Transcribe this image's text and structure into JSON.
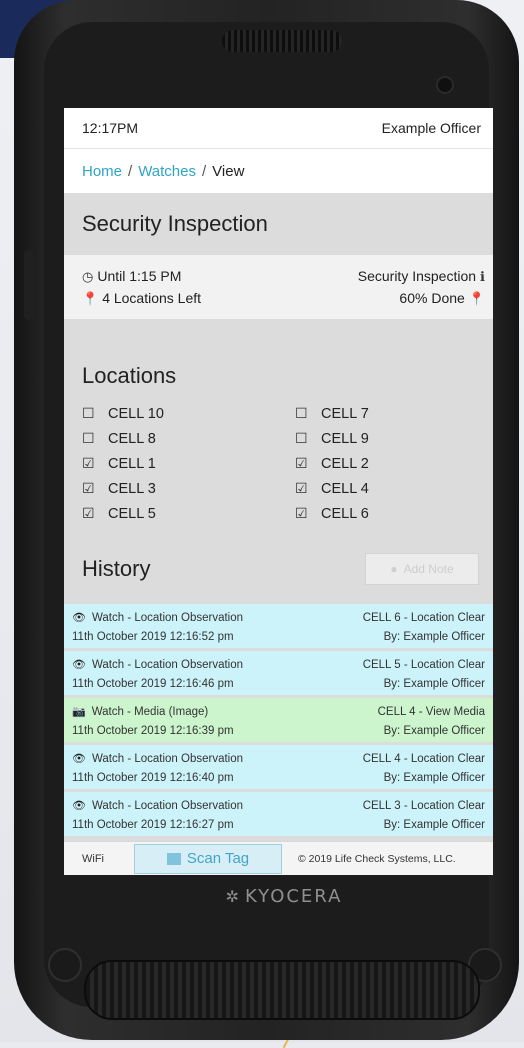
{
  "status_bar": {
    "time": "12:17PM",
    "user": "Example Officer"
  },
  "breadcrumb": {
    "home": "Home",
    "separator": "/",
    "watches": "Watches",
    "current": "View"
  },
  "watch": {
    "title": "Security Inspection",
    "until": "Until 1:15 PM",
    "type": "Security Inspection",
    "locations_left": "4 Locations Left",
    "done": "60% Done",
    "progress_fraction": 0.6
  },
  "locations": {
    "title": "Locations",
    "items": [
      {
        "label": "CELL 10",
        "checked": false
      },
      {
        "label": "CELL 7",
        "checked": false
      },
      {
        "label": "CELL 8",
        "checked": false
      },
      {
        "label": "CELL 9",
        "checked": false
      },
      {
        "label": "CELL 1",
        "checked": true
      },
      {
        "label": "CELL 2",
        "checked": true
      },
      {
        "label": "CELL 3",
        "checked": true
      },
      {
        "label": "CELL 4",
        "checked": true
      },
      {
        "label": "CELL 5",
        "checked": true
      },
      {
        "label": "CELL 6",
        "checked": true
      }
    ]
  },
  "history": {
    "title": "History",
    "add_note_label": "Add Note",
    "entries": [
      {
        "kind": "obs",
        "icon": "eye-icon",
        "event": "Watch - Location Observation",
        "timestamp": "11th October 2019 12:16:52 pm",
        "result": "CELL 6 - Location Clear",
        "by": "By: Example Officer"
      },
      {
        "kind": "obs",
        "icon": "eye-icon",
        "event": "Watch - Location Observation",
        "timestamp": "11th October 2019 12:16:46 pm",
        "result": "CELL 5 - Location Clear",
        "by": "By: Example Officer"
      },
      {
        "kind": "media",
        "icon": "camera-icon",
        "event": "Watch - Media (Image)",
        "timestamp": "11th October 2019 12:16:39 pm",
        "result": "CELL 4 - View Media",
        "by": "By: Example Officer"
      },
      {
        "kind": "obs",
        "icon": "eye-icon",
        "event": "Watch - Location Observation",
        "timestamp": "11th October 2019 12:16:40 pm",
        "result": "CELL 4 - Location Clear",
        "by": "By: Example Officer"
      },
      {
        "kind": "obs",
        "icon": "eye-icon",
        "event": "Watch - Location Observation",
        "timestamp": "11th October 2019 12:16:27 pm",
        "result": "CELL 3 - Location Clear",
        "by": "By: Example Officer"
      }
    ]
  },
  "footer": {
    "wifi": "WiFi",
    "scan_label": "Scan Tag",
    "copyright": "© 2019 Life Check Systems, LLC."
  },
  "device": {
    "brand": "KYOCERA"
  },
  "colors": {
    "link": "#2fa4c8",
    "observation_row": "#cdf3fa",
    "media_row": "#cdf5cd"
  }
}
